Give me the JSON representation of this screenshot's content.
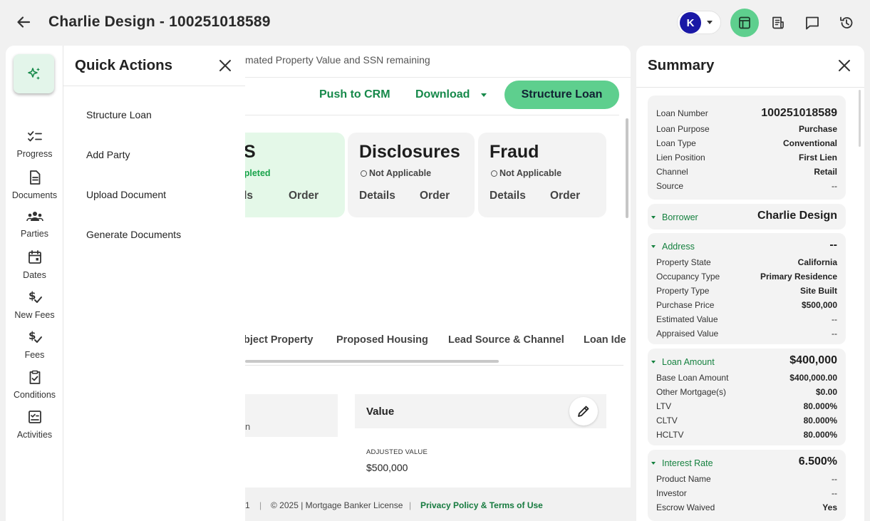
{
  "header": {
    "title": "Charlie Design - 100251018589",
    "user_initial": "K"
  },
  "rail": {
    "items": [
      {
        "label": "Progress"
      },
      {
        "label": "Documents"
      },
      {
        "label": "Parties"
      },
      {
        "label": "Dates"
      },
      {
        "label": "New Fees"
      },
      {
        "label": "Fees"
      },
      {
        "label": "Conditions"
      },
      {
        "label": "Activities"
      }
    ]
  },
  "quick_actions": {
    "title": "Quick Actions",
    "items": [
      {
        "label": "Structure Loan"
      },
      {
        "label": "Add Party"
      },
      {
        "label": "Upload Document"
      },
      {
        "label": "Generate Documents"
      }
    ]
  },
  "main": {
    "notice": "mated Property Value and SSN remaining",
    "push_crm": "Push to CRM",
    "download": "Download",
    "structure_loan": "Structure Loan",
    "cards": [
      {
        "title": "US",
        "status": "ompleted",
        "details": "tails",
        "order": "Order"
      },
      {
        "title": "Disclosures",
        "status": "Not Applicable",
        "details": "Details",
        "order": "Order"
      },
      {
        "title": "Fraud",
        "status": "Not Applicable",
        "details": "Details",
        "order": "Order"
      }
    ],
    "tabs": [
      {
        "label": "bject Property"
      },
      {
        "label": "Proposed Housing"
      },
      {
        "label": "Lead Source & Channel"
      },
      {
        "label": "Loan Ide"
      }
    ],
    "left_block_text": "n",
    "value_label": "Value",
    "adjusted_value_label": "ADJUSTED VALUE",
    "adjusted_value": "$500,000"
  },
  "footer": {
    "version_fragment": "1",
    "copyright": "© 2025 | Mortgage Banker License",
    "privacy": "Privacy Policy & Terms of Use"
  },
  "summary": {
    "title": "Summary",
    "loan": {
      "rows": [
        {
          "k": "Loan Number",
          "v": "100251018589"
        },
        {
          "k": "Loan Purpose",
          "v": "Purchase"
        },
        {
          "k": "Loan Type",
          "v": "Conventional"
        },
        {
          "k": "Lien Position",
          "v": "First Lien"
        },
        {
          "k": "Channel",
          "v": "Retail"
        },
        {
          "k": "Source",
          "v": "--"
        }
      ]
    },
    "borrower": {
      "k": "Borrower",
      "v": "Charlie Design"
    },
    "address": {
      "k": "Address",
      "v": "--",
      "rows": [
        {
          "k": "Property State",
          "v": "California"
        },
        {
          "k": "Occupancy Type",
          "v": "Primary Residence"
        },
        {
          "k": "Property Type",
          "v": "Site Built"
        },
        {
          "k": "Purchase Price",
          "v": "$500,000"
        },
        {
          "k": "Estimated Value",
          "v": "--"
        },
        {
          "k": "Appraised Value",
          "v": "--"
        }
      ]
    },
    "loan_amount": {
      "k": "Loan Amount",
      "v": "$400,000",
      "rows": [
        {
          "k": "Base Loan Amount",
          "v": "$400,000.00"
        },
        {
          "k": "Other Mortgage(s)",
          "v": "$0.00"
        },
        {
          "k": "LTV",
          "v": "80.000%"
        },
        {
          "k": "CLTV",
          "v": "80.000%"
        },
        {
          "k": "HCLTV",
          "v": "80.000%"
        }
      ]
    },
    "interest_rate": {
      "k": "Interest Rate",
      "v": "6.500%",
      "rows": [
        {
          "k": "Product Name",
          "v": "--"
        },
        {
          "k": "Investor",
          "v": "--"
        },
        {
          "k": "Escrow Waived",
          "v": "Yes"
        }
      ]
    }
  },
  "colors": {
    "accent": "#5ecf8e",
    "link": "#16894a",
    "avatar": "#1a18a6"
  }
}
